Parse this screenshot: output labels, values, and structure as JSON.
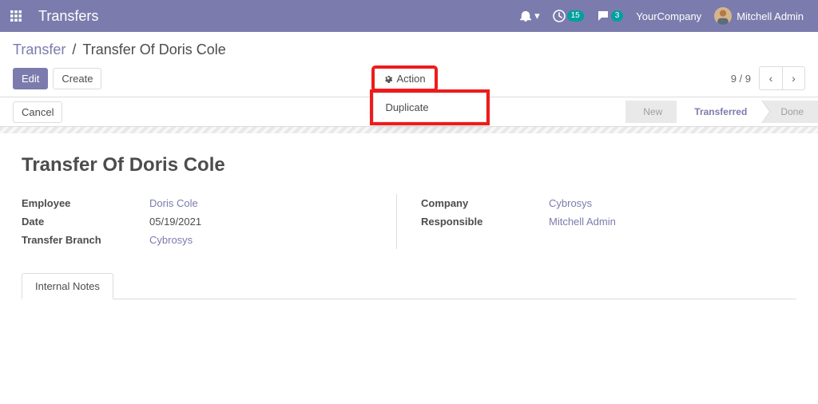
{
  "topbar": {
    "title": "Transfers",
    "activity_badge": "15",
    "discuss_badge": "3",
    "company": "YourCompany",
    "user_name": "Mitchell Admin"
  },
  "breadcrumb": {
    "parent": "Transfer",
    "current": "Transfer Of Doris Cole"
  },
  "buttons": {
    "edit": "Edit",
    "create": "Create",
    "action": "Action",
    "cancel": "Cancel"
  },
  "action_menu": {
    "duplicate": "Duplicate"
  },
  "pager": {
    "text": "9 / 9"
  },
  "status": {
    "new": "New",
    "transferred": "Transferred",
    "done": "Done"
  },
  "form": {
    "title": "Transfer Of Doris Cole",
    "labels": {
      "employee": "Employee",
      "date": "Date",
      "transfer_branch": "Transfer Branch",
      "company": "Company",
      "responsible": "Responsible"
    },
    "values": {
      "employee": "Doris Cole",
      "date": "05/19/2021",
      "transfer_branch": "Cybrosys",
      "company": "Cybrosys",
      "responsible": "Mitchell Admin"
    }
  },
  "tabs": {
    "internal_notes": "Internal Notes"
  }
}
